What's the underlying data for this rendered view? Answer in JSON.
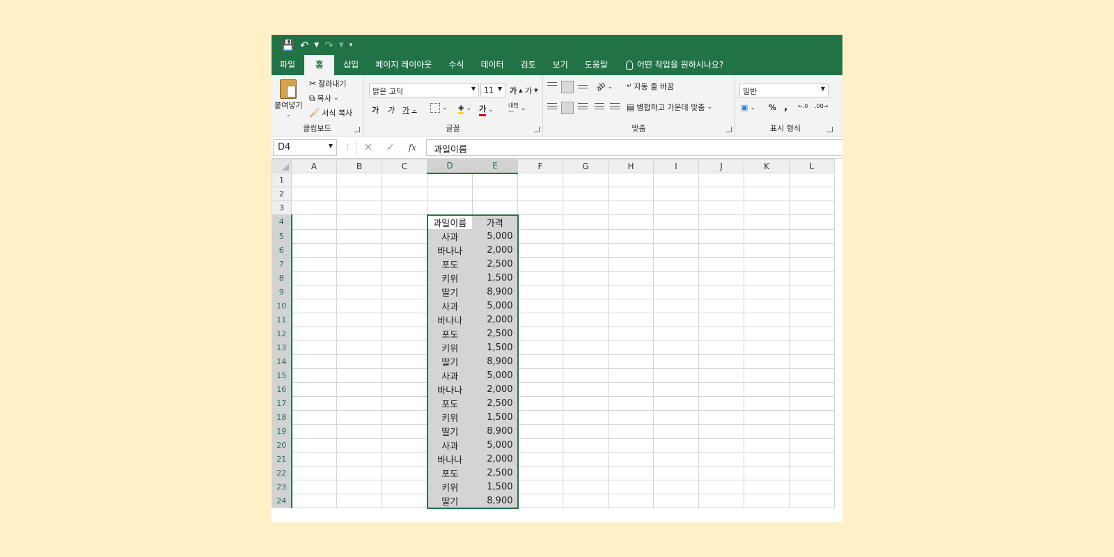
{
  "ribbon_tabs": {
    "file": "파일",
    "home": "홈",
    "insert": "삽입",
    "layout": "페이지 레이아웃",
    "formulas": "수식",
    "data": "데이터",
    "review": "검토",
    "view": "보기",
    "help": "도움말",
    "tell_me": "어떤 작업을 원하시나요?"
  },
  "clipboard": {
    "paste": "붙여넣기",
    "cut": "잘라내기",
    "copy": "복사",
    "format_painter": "서식 복사",
    "group_label": "클립보드"
  },
  "font": {
    "name": "맑은 고딕",
    "size": "11",
    "group_label": "글꼴"
  },
  "alignment": {
    "wrap_text": "자동 줄 바꿈",
    "merge_center": "병합하고 가운데 맞춤",
    "group_label": "맞춤"
  },
  "number": {
    "format": "일반",
    "percent": "%",
    "comma": ",",
    "group_label": "표시 형식"
  },
  "formula_bar": {
    "name_box": "D4",
    "content": "과일이름"
  },
  "colors": {
    "excel_green": "#217346",
    "background": "#fff0c8",
    "selection_fill": "#d4d4d4"
  },
  "sheet": {
    "columns": [
      "A",
      "B",
      "C",
      "D",
      "E",
      "F",
      "G",
      "H",
      "I",
      "J",
      "K",
      "L"
    ],
    "selected_columns": [
      "D",
      "E"
    ],
    "header_row": 4,
    "headers": [
      "과일이름",
      "가격"
    ],
    "rows": [
      [
        "사과",
        "5,000"
      ],
      [
        "바나나",
        "2,000"
      ],
      [
        "포도",
        "2,500"
      ],
      [
        "키위",
        "1,500"
      ],
      [
        "딸기",
        "8,900"
      ],
      [
        "사과",
        "5,000"
      ],
      [
        "바나나",
        "2,000"
      ],
      [
        "포도",
        "2,500"
      ],
      [
        "키위",
        "1,500"
      ],
      [
        "딸기",
        "8,900"
      ],
      [
        "사과",
        "5,000"
      ],
      [
        "바나나",
        "2,000"
      ],
      [
        "포도",
        "2,500"
      ],
      [
        "키위",
        "1,500"
      ],
      [
        "딸기",
        "8,900"
      ],
      [
        "사과",
        "5,000"
      ],
      [
        "바나나",
        "2,000"
      ],
      [
        "포도",
        "2,500"
      ],
      [
        "키위",
        "1,500"
      ],
      [
        "딸기",
        "8,900"
      ]
    ]
  }
}
